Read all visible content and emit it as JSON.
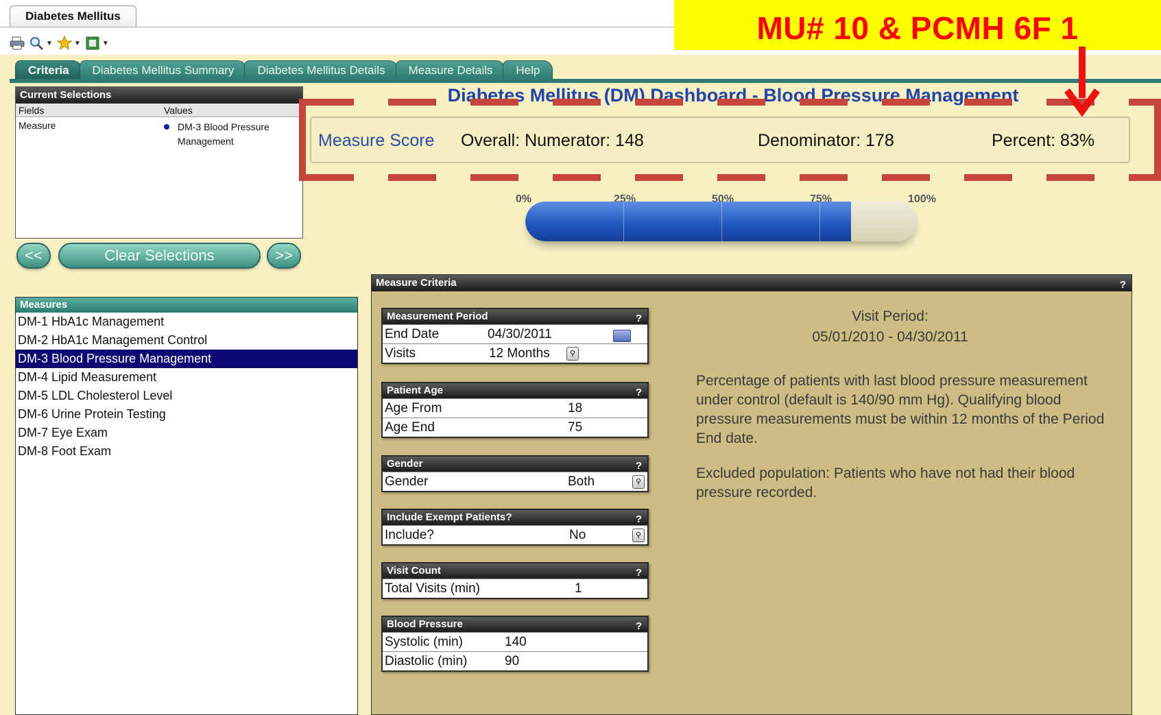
{
  "window": {
    "tab_title": "Diabetes Mellitus"
  },
  "toolbar": {
    "icons": [
      "print-icon",
      "zoom-icon",
      "favorites-star-icon",
      "export-excel-icon"
    ]
  },
  "annotation": {
    "label": "MU# 10 & PCMH 6F 1",
    "color": "#ff0000",
    "banner_color": "#ffff00"
  },
  "tabs": [
    {
      "label": "Criteria",
      "active": true
    },
    {
      "label": "Diabetes Mellitus Summary",
      "active": false
    },
    {
      "label": "Diabetes Mellitus Details",
      "active": false
    },
    {
      "label": "Measure Details",
      "active": false
    },
    {
      "label": "Help",
      "active": false
    }
  ],
  "current_selections": {
    "title": "Current Selections",
    "fields_header": "Fields",
    "values_header": "Values",
    "rows": [
      {
        "field": "Measure",
        "value": "DM-3 Blood Pressure Management"
      }
    ]
  },
  "nav": {
    "prev": "<<",
    "clear": "Clear Selections",
    "next": ">>"
  },
  "dashboard": {
    "title": "Diabetes Mellitus (DM) Dashboard - Blood Pressure Management",
    "measure_score_label": "Measure Score",
    "numerator_text": "Overall: Numerator: 148",
    "denominator_text": "Denominator: 178",
    "percent_text": "Percent: 83%",
    "numerator": 148,
    "denominator": 178,
    "percent": 83
  },
  "gauge": {
    "labels": [
      "0%",
      "25%",
      "50%",
      "75%",
      "100%"
    ],
    "value_percent": 83,
    "fill_color": "#1e56c0"
  },
  "measures": {
    "title": "Measures",
    "items": [
      {
        "label": "DM-1 HbA1c Management",
        "selected": false
      },
      {
        "label": "DM-2 HbA1c Management Control",
        "selected": false
      },
      {
        "label": "DM-3 Blood Pressure Management",
        "selected": true
      },
      {
        "label": "DM-4 Lipid Measurement",
        "selected": false
      },
      {
        "label": "DM-5 LDL Cholesterol Level",
        "selected": false
      },
      {
        "label": "DM-6 Urine Protein Testing",
        "selected": false
      },
      {
        "label": "DM-7 Eye Exam",
        "selected": false
      },
      {
        "label": "DM-8 Foot Exam",
        "selected": false
      }
    ]
  },
  "criteria": {
    "title": "Measure Criteria",
    "help": "?",
    "measurement_period": {
      "title": "Measurement Period",
      "end_date_label": "End Date",
      "end_date": "04/30/2011",
      "visits_label": "Visits",
      "visits": "12 Months"
    },
    "patient_age": {
      "title": "Patient Age",
      "from_label": "Age From",
      "from": "18",
      "end_label": "Age End",
      "end": "75"
    },
    "gender": {
      "title": "Gender",
      "label": "Gender",
      "value": "Both"
    },
    "exempt": {
      "title": "Include Exempt Patients?",
      "label": "Include?",
      "value": "No"
    },
    "visit_count": {
      "title": "Visit Count",
      "label": "Total Visits (min)",
      "value": "1"
    },
    "blood_pressure": {
      "title": "Blood Pressure",
      "systolic_label": "Systolic (min)",
      "systolic": "140",
      "diastolic_label": "Diastolic (min)",
      "diastolic": "90"
    },
    "visit_period_label": "Visit Period:",
    "visit_period": "05/01/2010 - 04/30/2011",
    "description": "Percentage of patients with last blood pressure measurement under control (default is 140/90 mm Hg).  Qualifying blood pressure measurements must be within 12 months of the Period End date.",
    "excluded": "Excluded population:  Patients who have not had their blood pressure recorded."
  }
}
